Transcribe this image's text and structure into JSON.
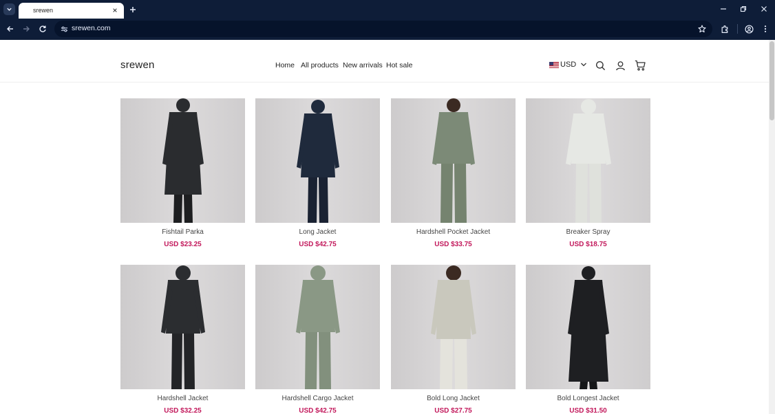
{
  "browser": {
    "tab_title": "srewen",
    "url": "srewen.com"
  },
  "site": {
    "logo": "srewen",
    "nav": [
      "Home",
      "All products",
      "New arrivals",
      "Hot sale"
    ],
    "currency": "USD"
  },
  "products": [
    {
      "name": "Fishtail Parka",
      "price": "USD $23.25",
      "color": "#2a2c2f"
    },
    {
      "name": "Long Jacket",
      "price": "USD $42.75",
      "color": "#1f2a3c"
    },
    {
      "name": "Hardshell Pocket Jacket",
      "price": "USD $33.75",
      "color": "#7c8a77"
    },
    {
      "name": "Breaker Spray",
      "price": "USD $18.75",
      "color": "#e6e8e4"
    },
    {
      "name": "Hardshell Jacket",
      "price": "USD $32.25",
      "color": "#2b2d30"
    },
    {
      "name": "Hardshell Cargo Jacket",
      "price": "USD $42.75",
      "color": "#8a9885"
    },
    {
      "name": "Bold Long Jacket",
      "price": "USD $27.75",
      "color": "#c9c8bd"
    },
    {
      "name": "Bold Longest Jacket",
      "price": "USD $31.50",
      "color": "#1e1f22"
    }
  ],
  "colors": {
    "price": "#c2185b",
    "chrome": "#0e1d38"
  }
}
